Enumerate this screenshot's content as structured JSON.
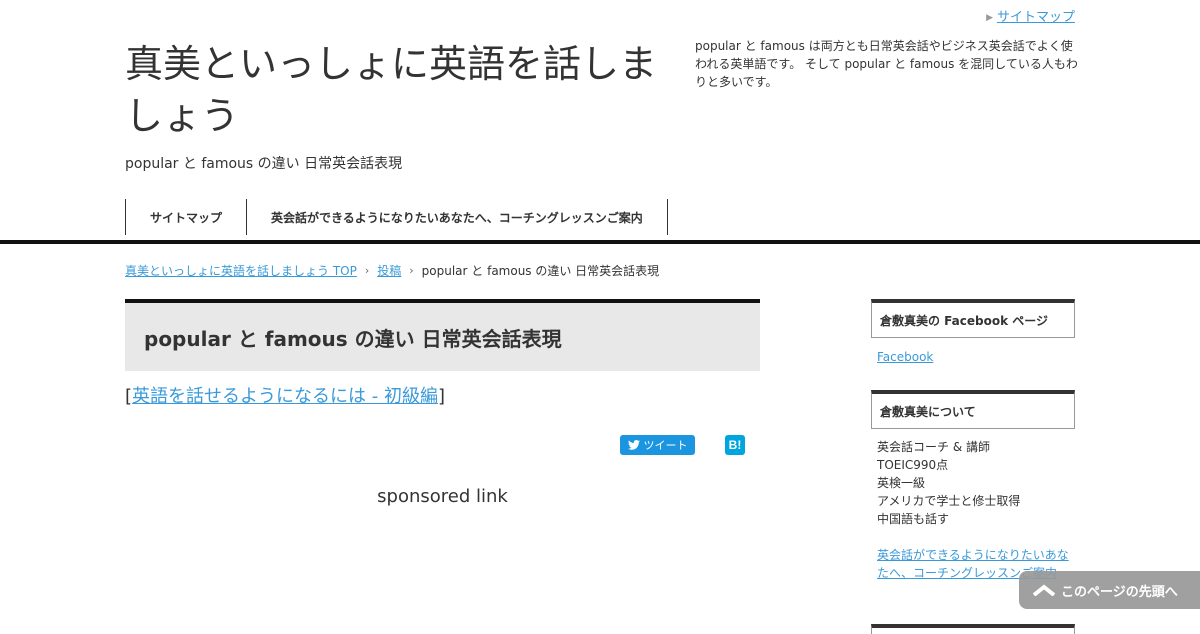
{
  "header": {
    "sitemap_link": "サイトマップ",
    "site_title": "真美といっしょに英語を話しましょう",
    "site_subtitle": "popular と famous の違い 日常英会話表現",
    "description": "popular と famous は両方とも日常英会話やビジネス英会話でよく使われる英単語です。 そして popular と famous を混同している人もわりと多いです。"
  },
  "nav": {
    "items": [
      {
        "label": "サイトマップ"
      },
      {
        "label": "英会話ができるようになりたいあなたへ、コーチングレッスンご案内"
      }
    ]
  },
  "breadcrumb": {
    "home": "真美といっしょに英語を話しましょう TOP",
    "section": "投稿",
    "current": "popular と famous の違い 日常英会話表現"
  },
  "post": {
    "title": "popular と famous の違い 日常英会話表現",
    "bracket_open": "[",
    "related_link": "英語を話せるようになるには - 初級編",
    "bracket_close": "]",
    "tweet_label": "ツイート",
    "hatena_label": "B!",
    "sponsored": "sponsored link"
  },
  "sidebar": {
    "fb_heading": "倉敷真美の Facebook ページ",
    "fb_link": "Facebook",
    "about_heading": "倉敷真美について",
    "about_lines": [
      "英会話コーチ & 講師",
      "TOEIC990点",
      "英検一級",
      "アメリカで学士と修士取得",
      "中国語も話す"
    ],
    "about_link": "英会話ができるようになりたいあなたへ、コーチングレッスンご案内"
  },
  "to_top": {
    "label": "このページの先頭へ"
  },
  "colors": {
    "link": "#3a9ad9",
    "twitter": "#1b95e0",
    "hatena": "#00a4de",
    "title_bg": "#e8e8e8"
  }
}
